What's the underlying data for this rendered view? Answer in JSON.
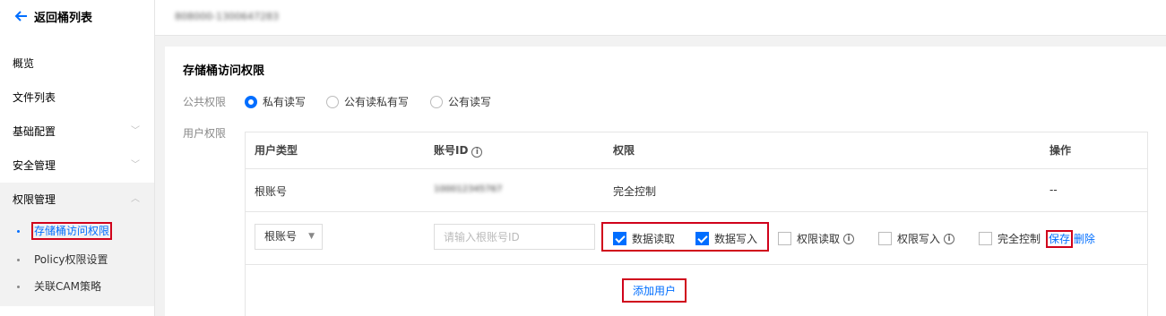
{
  "sidebar": {
    "back_label": "返回桶列表",
    "items": [
      {
        "label": "概览"
      },
      {
        "label": "文件列表"
      },
      {
        "label": "基础配置"
      },
      {
        "label": "安全管理"
      },
      {
        "label": "权限管理"
      }
    ],
    "sub_items": [
      {
        "label": "存储桶访问权限",
        "active": true
      },
      {
        "label": "Policy权限设置"
      },
      {
        "label": "关联CAM策略"
      }
    ]
  },
  "header": {
    "bucket_name": "808000-1300647283"
  },
  "panel": {
    "title": "存储桶访问权限",
    "public_label": "公共权限",
    "user_label": "用户权限",
    "radios": [
      {
        "label": "私有读写",
        "checked": true
      },
      {
        "label": "公有读私有写"
      },
      {
        "label": "公有读写"
      }
    ],
    "table": {
      "headers": {
        "user_type": "用户类型",
        "account_id": "账号ID",
        "permission": "权限",
        "action": "操作"
      },
      "row1": {
        "user_type": "根账号",
        "account_id": "100012345767",
        "permission": "完全控制",
        "action": "--"
      },
      "edit_row": {
        "select_value": "根账号",
        "input_placeholder": "请输入根账号ID",
        "checkboxes": [
          {
            "label": "数据读取",
            "checked": true
          },
          {
            "label": "数据写入",
            "checked": true
          },
          {
            "label": "权限读取",
            "checked": false
          },
          {
            "label": "权限写入",
            "checked": false
          },
          {
            "label": "完全控制",
            "checked": false
          }
        ],
        "save_label": "保存",
        "delete_label": "删除"
      },
      "add_user_label": "添加用户"
    }
  },
  "colors": {
    "accent": "#006eff",
    "highlight": "#d0021b"
  }
}
